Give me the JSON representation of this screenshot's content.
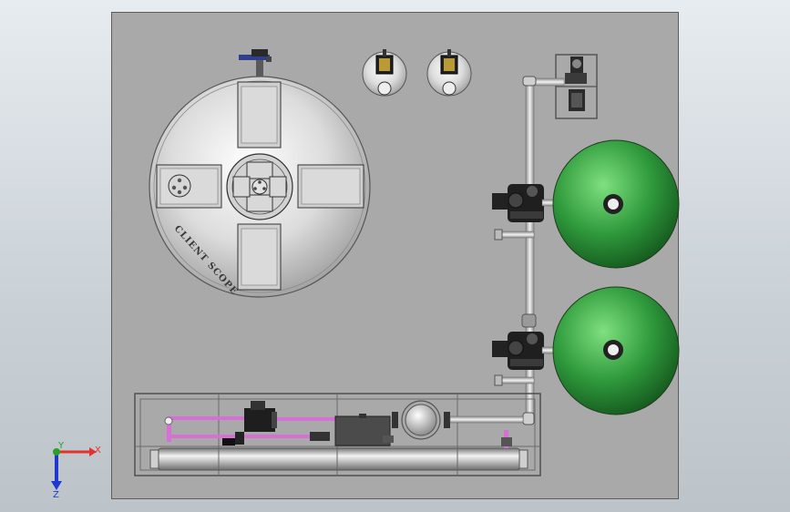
{
  "viewport": {
    "background": "#c9d0d6"
  },
  "plate": {
    "color": "#a9a9a9"
  },
  "tank_lid": {
    "engraving": "CLIENT SCOPE"
  },
  "filters": {
    "count": 2,
    "color": "#2f9a3c"
  },
  "triad": {
    "x_label": "X",
    "y_label": "Y",
    "z_label": "Z",
    "x_color": "#e53030",
    "y_color": "#2aa02a",
    "z_color": "#2038d0"
  }
}
